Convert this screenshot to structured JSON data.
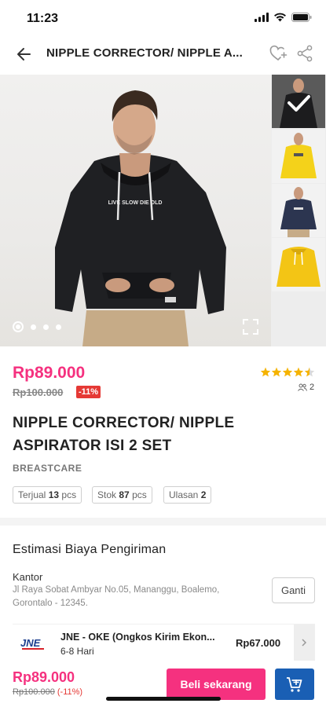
{
  "status_bar": {
    "time": "11:23"
  },
  "header": {
    "title": "NIPPLE CORRECTOR/ NIPPLE A..."
  },
  "gallery": {
    "image_count": 4,
    "active_index": 0,
    "print_text": "LIVE SLOW DIE OLD"
  },
  "product": {
    "price": "Rp89.000",
    "old_price": "Rp100.000",
    "discount": "-11%",
    "rating": 4.5,
    "review_count": "2",
    "title": "NIPPLE CORRECTOR/ NIPPLE ASPIRATOR ISI 2 SET",
    "brand": "BREASTCARE",
    "stats": {
      "sold_label": "Terjual",
      "sold_value": "13",
      "sold_unit": "pcs",
      "stock_label": "Stok",
      "stock_value": "87",
      "stock_unit": "pcs",
      "reviews_label": "Ulasan",
      "reviews_value": "2"
    }
  },
  "shipping": {
    "title": "Estimasi Biaya Pengiriman",
    "address_label": "Kantor",
    "address": "Jl Raya Sobat Ambyar No.05, Mananggu, Boalemo, Gorontalo - 12345.",
    "change_label": "Ganti",
    "courier": {
      "logo_text": "JNE",
      "name": "JNE - OKE (Ongkos Kirim Ekon...",
      "eta": "6-8 Hari",
      "price": "Rp67.000"
    }
  },
  "bottom_bar": {
    "price": "Rp89.000",
    "old_price": "Rp100.000",
    "discount": "(-11%)",
    "buy_label": "Beli sekarang"
  },
  "colors": {
    "accent": "#f5317f",
    "primary_blue": "#1a5fb4",
    "discount_red": "#e53935",
    "star": "#f5b301"
  }
}
